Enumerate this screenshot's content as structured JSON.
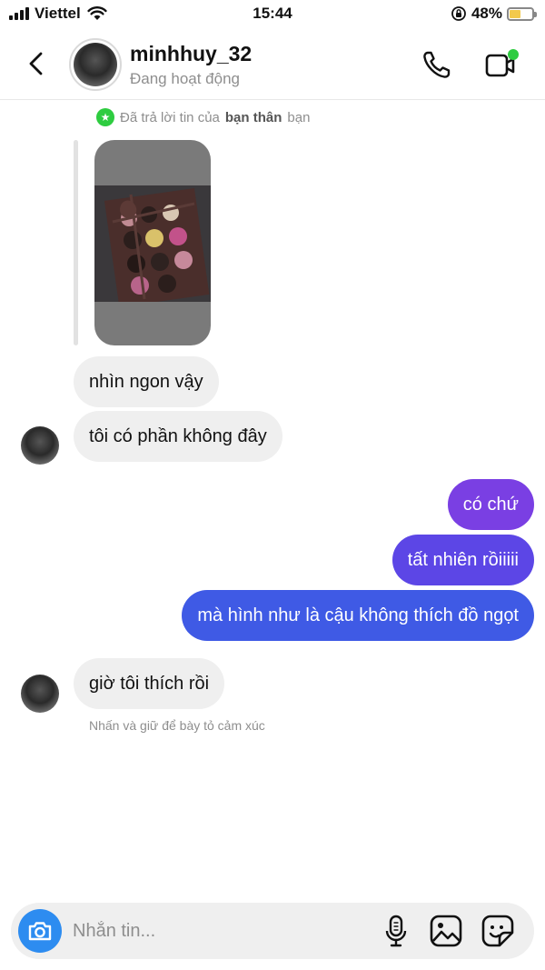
{
  "status_bar": {
    "carrier": "Viettel",
    "time": "15:44",
    "battery_percent": "48%",
    "battery_level": 0.48,
    "icons": [
      "signal-icon",
      "wifi-icon",
      "orientation-lock-icon",
      "battery-charging-icon"
    ]
  },
  "header": {
    "username": "minhhuy_32",
    "status": "Đang hoạt động",
    "icons": [
      "back-icon",
      "phone-icon",
      "video-call-icon"
    ],
    "online_dot_color": "#2ecc40"
  },
  "reply_note": {
    "prefix": "Đã trả lời tin của",
    "bold": "bạn thân",
    "suffix": "bạn"
  },
  "messages": [
    {
      "side": "in",
      "text": "nhìn ngon vậy"
    },
    {
      "side": "in",
      "text": "tôi có phần không đây"
    },
    {
      "side": "out",
      "text": "có chứ"
    },
    {
      "side": "out",
      "text": "tất nhiên rồiiiii"
    },
    {
      "side": "out",
      "text": "mà hình như là cậu không thích đồ ngọt"
    },
    {
      "side": "in",
      "text": "giờ tôi thích rồi"
    }
  ],
  "hint": "Nhấn và giữ để bày tỏ cảm xúc",
  "composer": {
    "placeholder": "Nhắn tin...",
    "icons": [
      "camera-icon",
      "microphone-icon",
      "gallery-icon",
      "sticker-icon"
    ]
  },
  "colors": {
    "incoming_bubble": "#efefef",
    "outgoing_gradient": [
      "#7b3fe4",
      "#5b45e8",
      "#3d5be6"
    ],
    "accent_blue": "#2d8cf0",
    "close_friends_green": "#2ecc40"
  }
}
